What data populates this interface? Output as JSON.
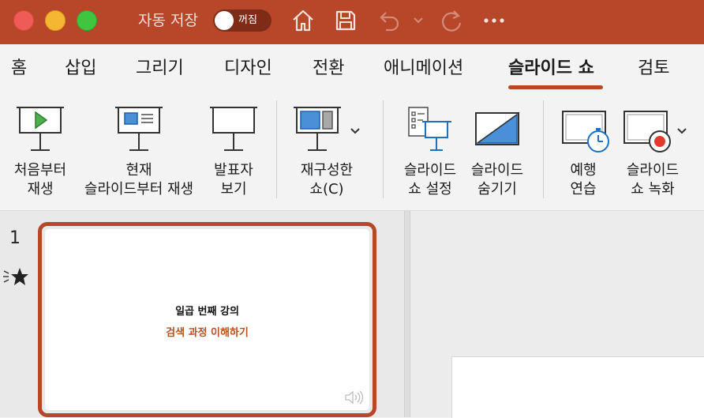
{
  "titlebar": {
    "autosave_label": "자동 저장",
    "autosave_state": "꺼짐",
    "accent_color": "#b8472a"
  },
  "tabs": [
    {
      "label": "홈"
    },
    {
      "label": "삽입"
    },
    {
      "label": "그리기"
    },
    {
      "label": "디자인"
    },
    {
      "label": "전환"
    },
    {
      "label": "애니메이션"
    },
    {
      "label": "슬라이드 쇼",
      "active": true
    },
    {
      "label": "검토"
    }
  ],
  "ribbon": {
    "from_beginning": {
      "line1": "처음부터",
      "line2": "재생"
    },
    "from_current": {
      "line1": "현재",
      "line2": "슬라이드부터 재생"
    },
    "presenter_view": {
      "line1": "발표자",
      "line2": "보기"
    },
    "custom_show": {
      "line1": "재구성한",
      "line2": "쇼(C)"
    },
    "setup_show": {
      "line1": "슬라이드",
      "line2": "쇼 설정"
    },
    "hide_slide": {
      "line1": "슬라이드",
      "line2": "숨기기"
    },
    "rehearse": {
      "line1": "예행",
      "line2": "연습"
    },
    "record": {
      "line1": "슬라이드",
      "line2": "쇼 녹화"
    }
  },
  "slides": [
    {
      "number": "1",
      "title": "일곱 번째 강의",
      "subtitle": "검색 과정 이해하기"
    }
  ]
}
